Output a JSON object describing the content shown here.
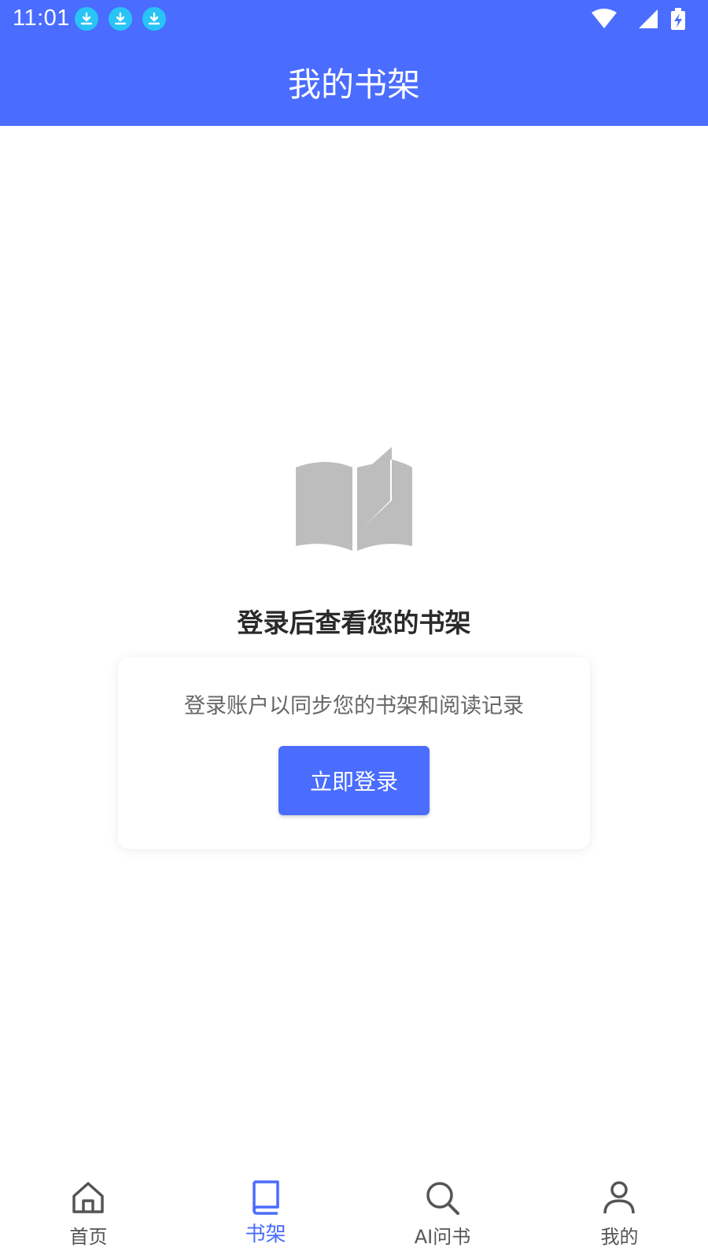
{
  "status_bar": {
    "time": "11:01"
  },
  "header": {
    "title": "我的书架"
  },
  "empty_state": {
    "title": "登录后查看您的书架",
    "description": "登录账户以同步您的书架和阅读记录",
    "login_label": "立即登录"
  },
  "tabs": [
    {
      "label": "首页",
      "icon": "home-icon",
      "active": false
    },
    {
      "label": "书架",
      "icon": "book-icon",
      "active": true
    },
    {
      "label": "AI问书",
      "icon": "search-icon",
      "active": false
    },
    {
      "label": "我的",
      "icon": "user-icon",
      "active": false
    }
  ],
  "colors": {
    "accent": "#4a6cff",
    "download_badge": "#27c4f5",
    "empty_icon": "#bdbdbd"
  }
}
